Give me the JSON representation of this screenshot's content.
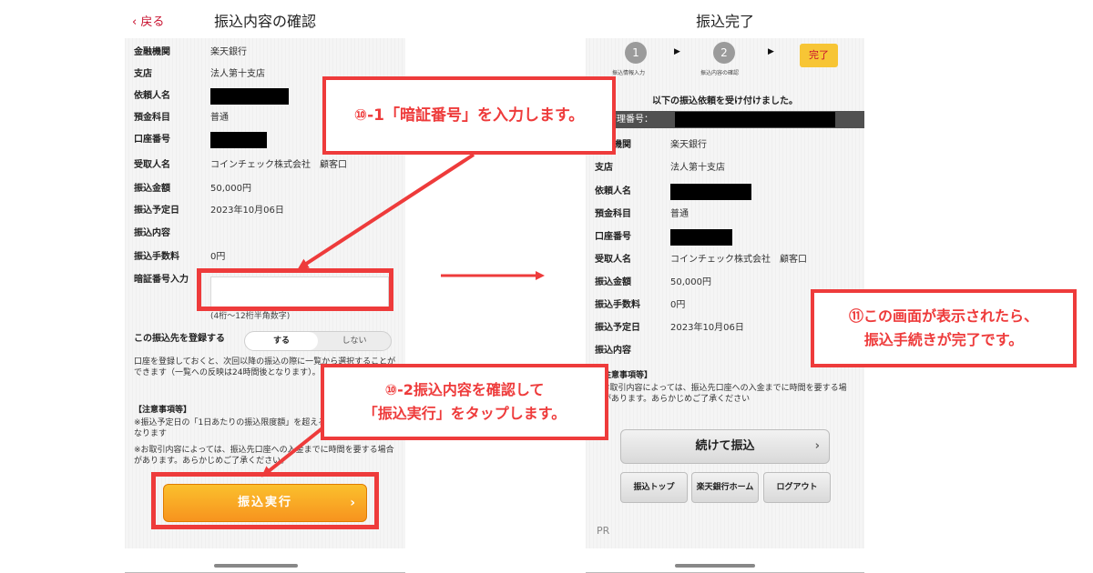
{
  "left": {
    "back_label": "戻る",
    "title": "振込内容の確認",
    "rows": [
      {
        "label": "金融機関",
        "value": "楽天銀行"
      },
      {
        "label": "支店",
        "value": "法人第十支店"
      },
      {
        "label": "依頼人名",
        "value": ""
      },
      {
        "label": "預金科目",
        "value": "普通"
      },
      {
        "label": "口座番号",
        "value": ""
      },
      {
        "label": "受取人名",
        "value": "コインチェック株式会社　顧客口"
      },
      {
        "label": "振込金額",
        "value": "50,000円"
      },
      {
        "label": "振込予定日",
        "value": "2023年10月06日"
      },
      {
        "label": "振込内容",
        "value": ""
      },
      {
        "label": "振込手数料",
        "value": "0円"
      },
      {
        "label": "暗証番号入力",
        "value": ""
      }
    ],
    "pin_hint": "(4桁〜12桁半角数字)",
    "register_label": "この振込先を登録する",
    "register_options": [
      "する",
      "しない"
    ],
    "register_note": "口座を登録しておくと、次回以降の振込の際に一覧から選択することができます（一覧への反映は24時間後となります）。",
    "notice_title": "【注意事項等】",
    "notice_1": "※振込予定日の「1日あたりの振込限度額」を超える場合は振込不能となります",
    "notice_2": "※お取引内容によっては、振込先口座への入金までに時間を要する場合があります。あらかじめご了承ください。",
    "execute_label": "振込実行"
  },
  "right": {
    "title": "振込完了",
    "steps": [
      {
        "num": "1",
        "caption": "振込情報入力"
      },
      {
        "num": "2",
        "caption": "振込内容の確認"
      }
    ],
    "step_done": "完了",
    "accepted": "以下の振込依頼を受け付けました。",
    "mgmt_label": "管理番号：",
    "rows": [
      {
        "label": "金融機関",
        "value": "楽天銀行"
      },
      {
        "label": "支店",
        "value": "法人第十支店"
      },
      {
        "label": "依頼人名",
        "value": ""
      },
      {
        "label": "預金科目",
        "value": "普通"
      },
      {
        "label": "口座番号",
        "value": ""
      },
      {
        "label": "受取人名",
        "value": "コインチェック株式会社　顧客口"
      },
      {
        "label": "振込金額",
        "value": "50,000円"
      },
      {
        "label": "振込手数料",
        "value": "0円"
      },
      {
        "label": "振込予定日",
        "value": "2023年10月06日"
      },
      {
        "label": "振込内容",
        "value": ""
      }
    ],
    "notice_title": "【注意事項等】",
    "notice_body": "※お取引内容によっては、振込先口座への入金までに時間を要する場合があります。あらかじめご了承ください",
    "continue_label": "続けて振込",
    "buttons": [
      "振込トップ",
      "楽天銀行ホーム",
      "ログアウト"
    ],
    "pr": "PR"
  },
  "annotations": {
    "step10_1": "⑩-1「暗証番号」を入力します。",
    "step10_2_line1": "⑩-2振込内容を確認して",
    "step10_2_line2": "「振込実行」をタップします。",
    "step11_line1": "⑪この画面が表示されたら、",
    "step11_line2": "振込手続きが完了です。"
  },
  "colors": {
    "annotation_red": "#ee3b3b",
    "execute_orange": "#f7931e",
    "rakuten_red": "#c8102e"
  }
}
